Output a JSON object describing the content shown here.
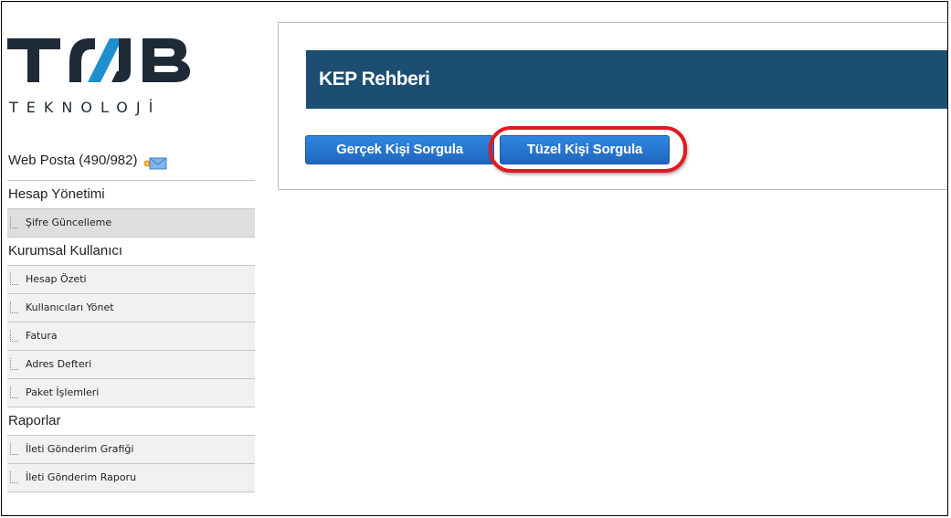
{
  "logo": {
    "name": "TNB",
    "tagline": "TEKNOLOJİ",
    "colors": {
      "primary": "#1e2a38",
      "accent": "#1d8fcf"
    }
  },
  "sidebar": {
    "webposta": {
      "label": "Web Posta (490/982)",
      "icon": "mail-icon"
    },
    "sections": [
      {
        "title": "Hesap Yönetimi",
        "items": [
          {
            "label": "Şifre Güncelleme",
            "active": true
          }
        ]
      },
      {
        "title": "Kurumsal Kullanıcı",
        "items": [
          {
            "label": "Hesap Özeti"
          },
          {
            "label": "Kullanıcıları Yönet"
          },
          {
            "label": "Fatura"
          },
          {
            "label": "Adres Defteri"
          },
          {
            "label": "Paket İşlemleri"
          }
        ]
      },
      {
        "title": "Raporlar",
        "items": [
          {
            "label": "İleti Gönderim Grafiği"
          },
          {
            "label": "İleti Gönderim Raporu"
          }
        ]
      }
    ]
  },
  "main": {
    "title": "KEP Rehberi",
    "buttons": {
      "real_person": "Gerçek Kişi Sorgula",
      "legal_person": "Tüzel Kişi Sorgula"
    }
  },
  "colors": {
    "header_bg": "#1b4e71",
    "button": "#2a7bd4",
    "highlight": "#e01a23"
  }
}
